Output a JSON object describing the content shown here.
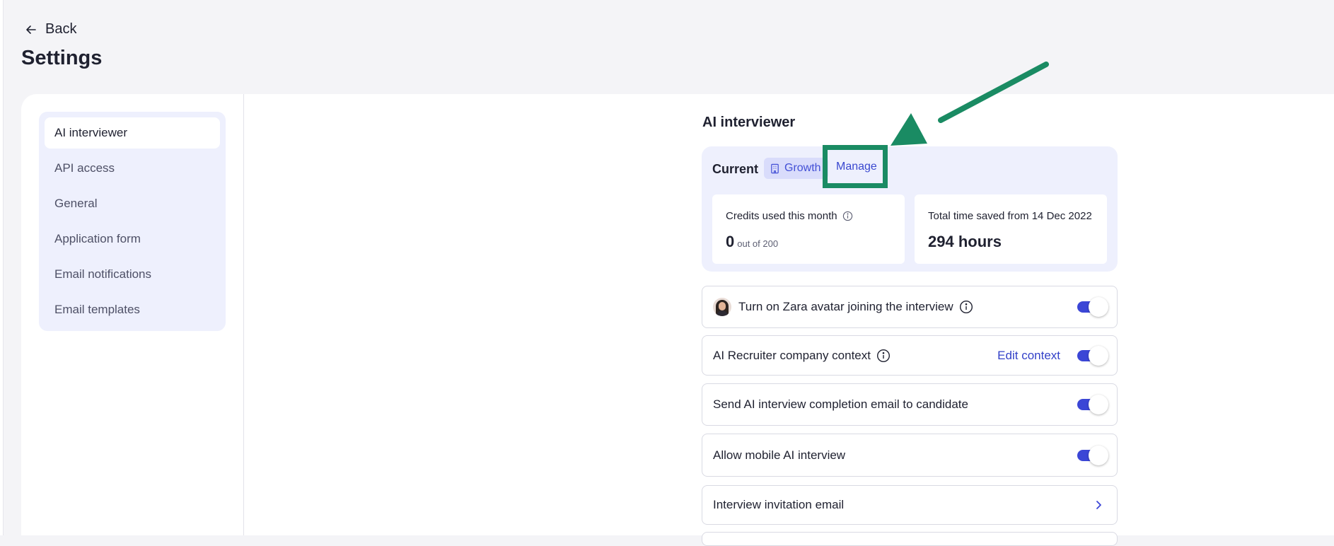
{
  "nav": {
    "back_label": "Back"
  },
  "page": {
    "title": "Settings"
  },
  "sidebar": {
    "items": [
      {
        "label": "AI interviewer",
        "active": true
      },
      {
        "label": "API access"
      },
      {
        "label": "General"
      },
      {
        "label": "Application form"
      },
      {
        "label": "Email notifications"
      },
      {
        "label": "Email templates"
      }
    ]
  },
  "main": {
    "section_title": "AI interviewer",
    "plan": {
      "current_label": "Current",
      "badge_label": "Growth",
      "manage_label": "Manage"
    },
    "credits": {
      "label": "Credits used this month",
      "value": "0",
      "sub": "out of 200"
    },
    "time_saved": {
      "label": "Total time saved from 14 Dec 2022",
      "value": "294 hours"
    },
    "settings": [
      {
        "label": "Turn on Zara avatar joining the interview",
        "toggle_on": true
      },
      {
        "label": "AI Recruiter company context",
        "action_label": "Edit context",
        "toggle_on": true
      },
      {
        "label": "Send AI interview completion email to candidate",
        "toggle_on": true
      },
      {
        "label": "Allow mobile AI interview",
        "toggle_on": true
      },
      {
        "label": "Interview invitation email"
      }
    ]
  },
  "colors": {
    "accent": "#3b46d6",
    "annotation": "#1a8b63",
    "card_background": "#eef0fd"
  }
}
